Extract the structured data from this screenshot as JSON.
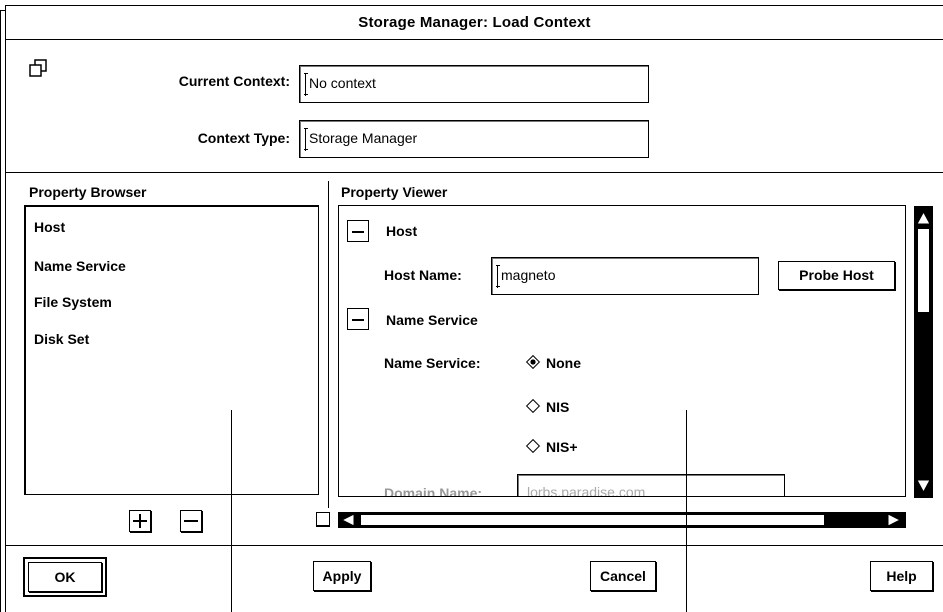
{
  "window": {
    "title": "Storage Manager: Load Context"
  },
  "context": {
    "current_context_label": "Current Context:",
    "current_context_value": "No context",
    "context_type_label": "Context Type:",
    "context_type_value": "Storage Manager"
  },
  "browser": {
    "title": "Property Browser",
    "items": [
      "Host",
      "Name Service",
      "File System",
      "Disk Set"
    ],
    "add_label": "+",
    "remove_label": "−"
  },
  "viewer": {
    "title": "Property Viewer",
    "host_section": "Host",
    "host_name_label": "Host Name:",
    "host_name_value": "magneto",
    "probe_button": "Probe Host",
    "ns_section": "Name Service",
    "ns_label": "Name Service:",
    "ns_options": [
      "None",
      "NIS",
      "NIS+"
    ],
    "ns_selected": "None",
    "domain_label": "Domain Name:",
    "domain_value": "lorbs.paradise.com"
  },
  "footer": {
    "ok": "OK",
    "apply": "Apply",
    "cancel": "Cancel",
    "help": "Help"
  }
}
